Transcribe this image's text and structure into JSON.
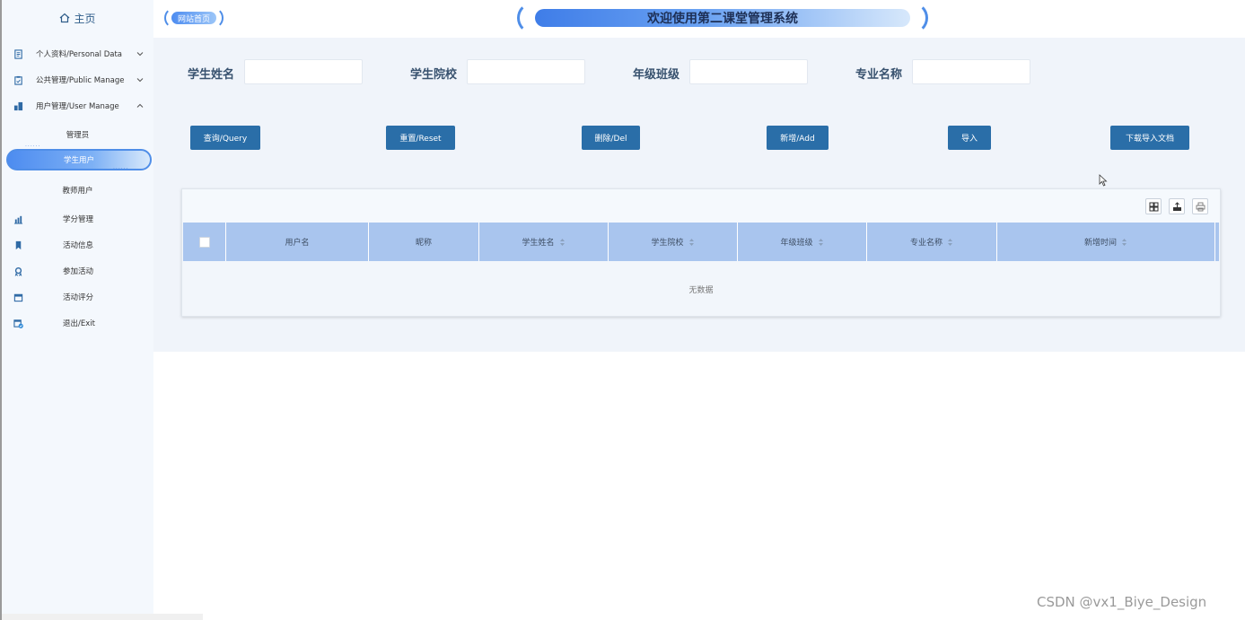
{
  "sidebar": {
    "home_label": "主页",
    "items": [
      {
        "label": "个人资料/Personal Data",
        "icon": "document-icon"
      },
      {
        "label": "公共管理/Public Manage",
        "icon": "clipboard-icon"
      },
      {
        "label": "用户管理/User Manage",
        "icon": "building-icon"
      }
    ],
    "sub_items": [
      {
        "label": "管理员"
      },
      {
        "label": "学生用户"
      },
      {
        "label": "教师用户"
      }
    ],
    "items2": [
      {
        "label": "学分管理",
        "icon": "chart-icon"
      },
      {
        "label": "活动信息",
        "icon": "bookmark-icon"
      },
      {
        "label": "参加活动",
        "icon": "award-icon"
      },
      {
        "label": "活动评分",
        "icon": "calendar-icon"
      },
      {
        "label": "退出/Exit",
        "icon": "calendar-check-icon"
      }
    ],
    "dots": "······"
  },
  "header": {
    "home_link": "网站首页",
    "title": "欢迎使用第二课堂管理系统"
  },
  "search": {
    "fields": [
      {
        "label": "学生姓名",
        "value": ""
      },
      {
        "label": "学生院校",
        "value": ""
      },
      {
        "label": "年级班级",
        "value": ""
      },
      {
        "label": "专业名称",
        "value": ""
      }
    ]
  },
  "actions": {
    "query": "查询/Query",
    "reset": "重置/Reset",
    "delete": "删除/Del",
    "add": "新增/Add",
    "import": "导入",
    "download": "下载导入文档"
  },
  "table": {
    "columns": [
      {
        "label": "用户名",
        "sortable": false
      },
      {
        "label": "昵称",
        "sortable": false
      },
      {
        "label": "学生姓名",
        "sortable": true
      },
      {
        "label": "学生院校",
        "sortable": true
      },
      {
        "label": "年级班级",
        "sortable": true
      },
      {
        "label": "专业名称",
        "sortable": true
      },
      {
        "label": "新增时间",
        "sortable": true
      }
    ],
    "empty_text": "无数据",
    "tools": [
      "columns-icon",
      "export-icon",
      "print-icon"
    ]
  },
  "watermark": "CSDN @vx1_Biye_Design",
  "colors": {
    "primary_button": "#2a6ea8",
    "table_header": "#a9c5ee",
    "content_bg": "#f0f4fa",
    "sidebar_bg": "#f4f8fd",
    "accent": "#4f8ee8"
  }
}
